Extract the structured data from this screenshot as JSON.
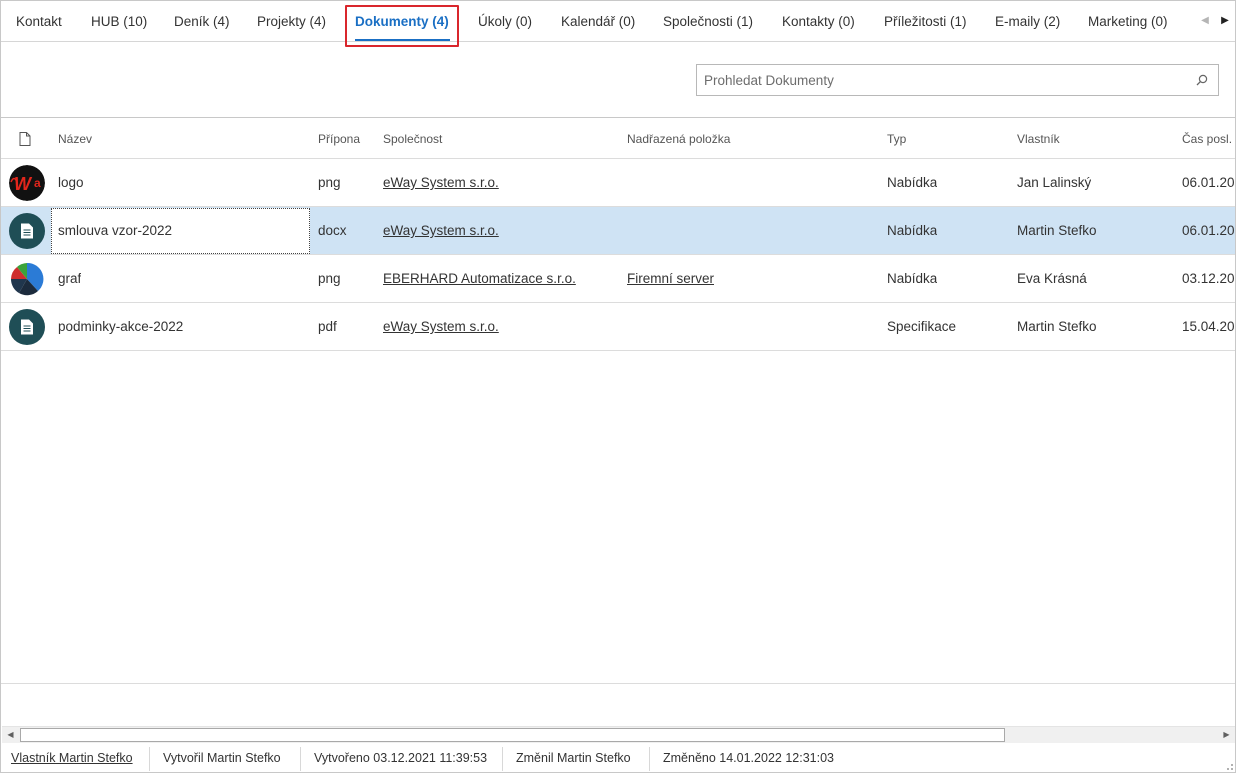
{
  "tabs": [
    {
      "label": "Kontakt"
    },
    {
      "label": "HUB (10)"
    },
    {
      "label": "Deník (4)"
    },
    {
      "label": "Projekty (4)"
    },
    {
      "label": "Dokumenty (4)"
    },
    {
      "label": "Úkoly (0)"
    },
    {
      "label": "Kalendář (0)"
    },
    {
      "label": "Společnosti (1)"
    },
    {
      "label": "Kontakty (0)"
    },
    {
      "label": "Příležitosti (1)"
    },
    {
      "label": "E-maily (2)"
    },
    {
      "label": "Marketing (0)"
    }
  ],
  "active_tab": "Dokumenty (4)",
  "search": {
    "placeholder": "Prohledat Dokumenty",
    "value": ""
  },
  "columns": [
    "Název",
    "Přípona",
    "Společnost",
    "Nadřazená položka",
    "Typ",
    "Vlastník",
    "Čas posl. z"
  ],
  "rows": [
    {
      "icon": "company-logo-thumbnail",
      "name": "logo",
      "ext": "png",
      "company": "eWay System s.r.o.",
      "parent": "",
      "type": "Nabídka",
      "owner": "Jan Lalinský",
      "time": "06.01.20"
    },
    {
      "icon": "document-icon",
      "name": "smlouva vzor-2022",
      "ext": "docx",
      "company": "eWay System s.r.o.",
      "parent": "",
      "type": "Nabídka",
      "owner": "Martin Stefko",
      "time": "06.01.20",
      "selected": true
    },
    {
      "icon": "pie-chart-thumbnail",
      "name": "graf",
      "ext": "png",
      "company": "EBERHARD Automatizace s.r.o.",
      "parent": "Firemní server",
      "type": "Nabídka",
      "owner": "Eva Krásná",
      "time": "03.12.20"
    },
    {
      "icon": "document-icon",
      "name": "podminky-akce-2022",
      "ext": "pdf",
      "company": "eWay System s.r.o.",
      "parent": "",
      "type": "Specifikace",
      "owner": "Martin Stefko",
      "time": "15.04.20"
    }
  ],
  "status": {
    "owner": "Vlastník Martin Stefko",
    "created_by": "Vytvořil Martin Stefko",
    "created": "Vytvořeno 03.12.2021 11:39:53",
    "changed_by": "Změnil Martin Stefko",
    "changed": "Změněno 14.01.2022 12:31:03"
  },
  "colors": {
    "accent": "#1a6fc4",
    "selected_row": "#cfe3f4",
    "highlight_box": "#d9262c",
    "doc_icon_bg": "#1f4e56"
  }
}
